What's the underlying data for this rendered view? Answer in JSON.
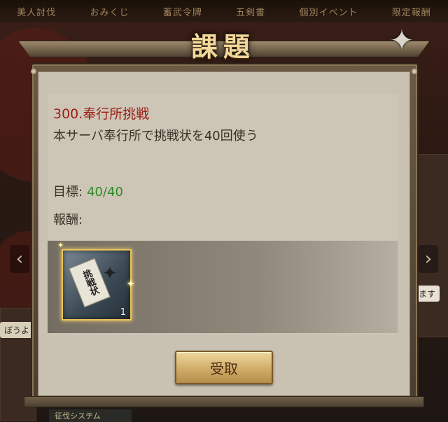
{
  "background": {
    "nav_tabs": [
      "美人討伐",
      "おみくじ",
      "蓄武令牌",
      "五剣書",
      "個別イベント",
      "限定報酬"
    ],
    "side_labels": {
      "right_small": "ます",
      "left_small": "ぼうよ",
      "bottom": "征伐システム"
    }
  },
  "dialog": {
    "title": "課題",
    "task": {
      "title": "300.奉行所挑戦",
      "description": "本サーバ奉行所で挑戦状を40回使う",
      "goal_label": "目標:",
      "goal_value": "40/40",
      "reward_label": "報酬:"
    },
    "reward_items": [
      {
        "name": "挑戦状",
        "count": "1"
      }
    ],
    "accept_button": "受取"
  },
  "colors": {
    "task_title": "#9a1c14",
    "goal_value": "#2f8a22",
    "title_gold": "#f3d89a",
    "button_gold": "#d0ad69"
  },
  "icons": {
    "corner": "shuriken-icon",
    "side_left": "chevron-left-icon",
    "side_right": "chevron-right-icon"
  }
}
